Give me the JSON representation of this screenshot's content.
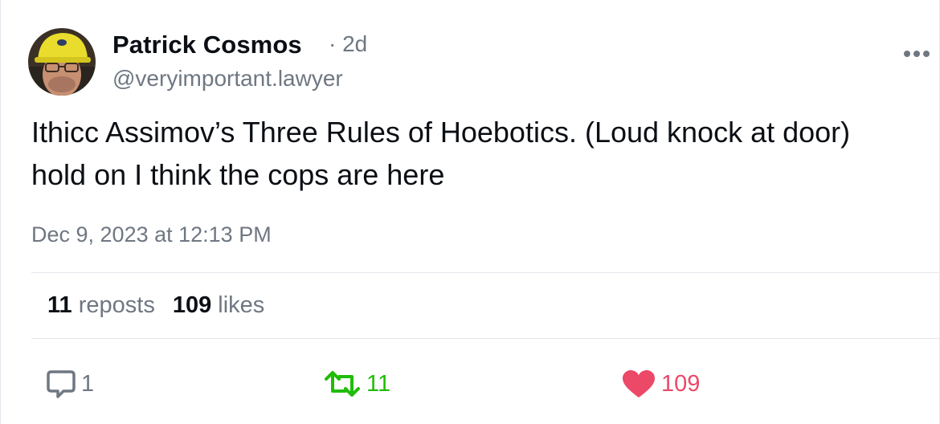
{
  "author": {
    "display_name": "Patrick Cosmos",
    "handle": "@veryimportant.lawyer",
    "separator": "·",
    "relative_time": "2d",
    "avatar_icon": "profile-photo"
  },
  "post": {
    "text": "Ithicc Assimov’s Three Rules of Hoebotics. (Loud knock at door) hold on I think the cops are here",
    "timestamp": "Dec 9, 2023 at 12:13 PM"
  },
  "stats": {
    "reposts_count": "11",
    "reposts_label": "reposts",
    "likes_count": "109",
    "likes_label": "likes"
  },
  "actions": {
    "reply_count": "1",
    "repost_count": "11",
    "like_count": "109",
    "reply_icon": "speech-bubble-icon",
    "repost_icon": "repost-arrows-icon",
    "like_icon": "heart-icon",
    "more_icon": "ellipsis-icon"
  },
  "colors": {
    "text_primary": "#0b0f14",
    "text_secondary": "#6f7782",
    "repost_active": "#20bc07",
    "like_active": "#ec4868",
    "divider": "#e3e7ec"
  }
}
